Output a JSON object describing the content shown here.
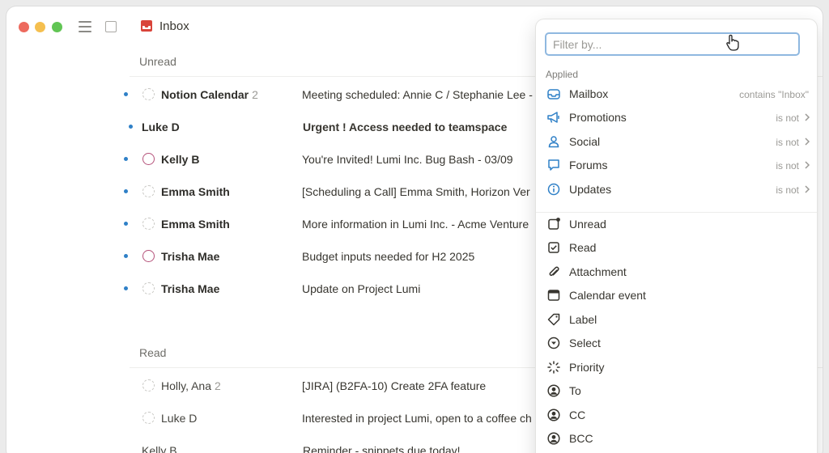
{
  "window": {
    "title": "Inbox"
  },
  "colors": {
    "accent_blue": "#2f80c7",
    "focus_ring": "#8fb8e0",
    "inbox_red": "#d9443a",
    "pink_circle": "#b5527a"
  },
  "sections": {
    "unread": {
      "label": "Unread",
      "rows": [
        {
          "sender": "Notion Calendar",
          "count": "2",
          "subject": "Meeting scheduled: Annie C / Stephanie Lee -"
        },
        {
          "sender": "Luke D",
          "count": "",
          "subject": "Urgent ! Access needed to teamspace"
        },
        {
          "sender": "Kelly B",
          "count": "",
          "subject": "You're Invited! Lumi Inc. Bug Bash - 03/09"
        },
        {
          "sender": "Emma Smith",
          "count": "",
          "subject": "[Scheduling a Call] Emma Smith, Horizon Ver"
        },
        {
          "sender": "Emma Smith",
          "count": "",
          "subject": "More information in Lumi Inc. - Acme Venture"
        },
        {
          "sender": "Trisha Mae",
          "count": "",
          "subject": "Budget inputs needed for H2 2025"
        },
        {
          "sender": "Trisha Mae",
          "count": "",
          "subject": "Update on Project Lumi"
        }
      ]
    },
    "read": {
      "label": "Read",
      "rows": [
        {
          "sender": "Holly, Ana",
          "count": "2",
          "subject": "[JIRA] (B2FA-10) Create 2FA feature"
        },
        {
          "sender": "Luke D",
          "count": "",
          "subject": "Interested in project Lumi, open to a coffee ch"
        },
        {
          "sender": "Kelly B",
          "count": "",
          "subject": "Reminder - snippets due today!"
        }
      ]
    }
  },
  "filter": {
    "placeholder": "Filter by...",
    "value": "",
    "applied_label": "Applied",
    "applied": [
      {
        "label": "Mailbox",
        "value": "contains \"Inbox\"",
        "icon": "mailbox-icon"
      },
      {
        "label": "Promotions",
        "value": "is not",
        "icon": "megaphone-icon"
      },
      {
        "label": "Social",
        "value": "is not",
        "icon": "person-icon"
      },
      {
        "label": "Forums",
        "value": "is not",
        "icon": "chat-bubble-icon"
      },
      {
        "label": "Updates",
        "value": "is not",
        "icon": "info-icon"
      }
    ],
    "options": [
      {
        "label": "Unread",
        "icon": "unread-square-icon"
      },
      {
        "label": "Read",
        "icon": "checkbox-icon"
      },
      {
        "label": "Attachment",
        "icon": "paperclip-icon"
      },
      {
        "label": "Calendar event",
        "icon": "calendar-icon"
      },
      {
        "label": "Label",
        "icon": "tag-icon"
      },
      {
        "label": "Select",
        "icon": "chevron-circle-icon"
      },
      {
        "label": "Priority",
        "icon": "priority-spinner-icon"
      },
      {
        "label": "To",
        "icon": "user-circle-icon"
      },
      {
        "label": "CC",
        "icon": "user-circle-icon"
      },
      {
        "label": "BCC",
        "icon": "user-circle-icon"
      }
    ]
  }
}
